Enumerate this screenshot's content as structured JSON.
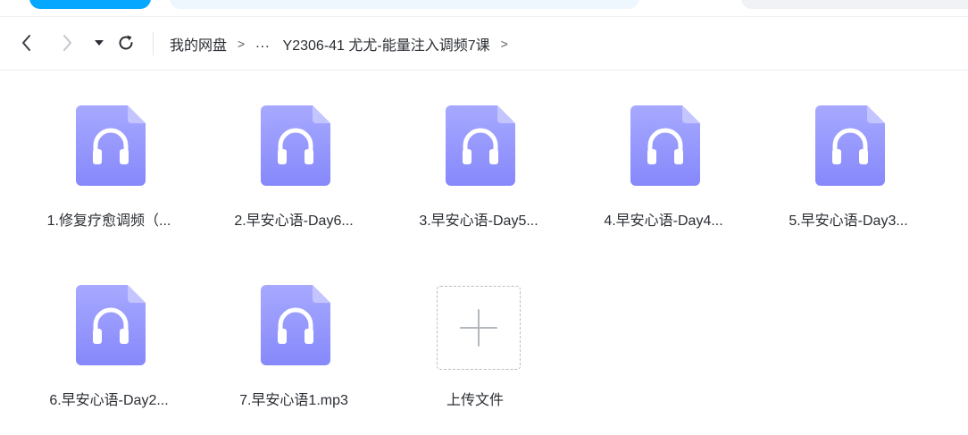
{
  "breadcrumb": {
    "root": "我的网盘",
    "ellipsis": "...",
    "current": "Y2306-41 尤尤-能量注入调频7课"
  },
  "files": [
    {
      "name": "1.修复疗愈调频（..."
    },
    {
      "name": "2.早安心语-Day6..."
    },
    {
      "name": "3.早安心语-Day5..."
    },
    {
      "name": "4.早安心语-Day4..."
    },
    {
      "name": "5.早安心语-Day3..."
    },
    {
      "name": "6.早安心语-Day2..."
    },
    {
      "name": "7.早安心语1.mp3"
    }
  ],
  "upload": {
    "label": "上传文件"
  },
  "icons": {
    "file": "audio-file-icon",
    "back": "chevron-left-icon",
    "forward": "chevron-right-icon",
    "dropdown": "caret-down-icon",
    "refresh": "refresh-icon",
    "upload": "plus-icon"
  },
  "colors": {
    "file_icon_top": "#a7a9ff",
    "file_icon_bottom": "#8688fb",
    "accent_blue": "#06a7ff"
  }
}
